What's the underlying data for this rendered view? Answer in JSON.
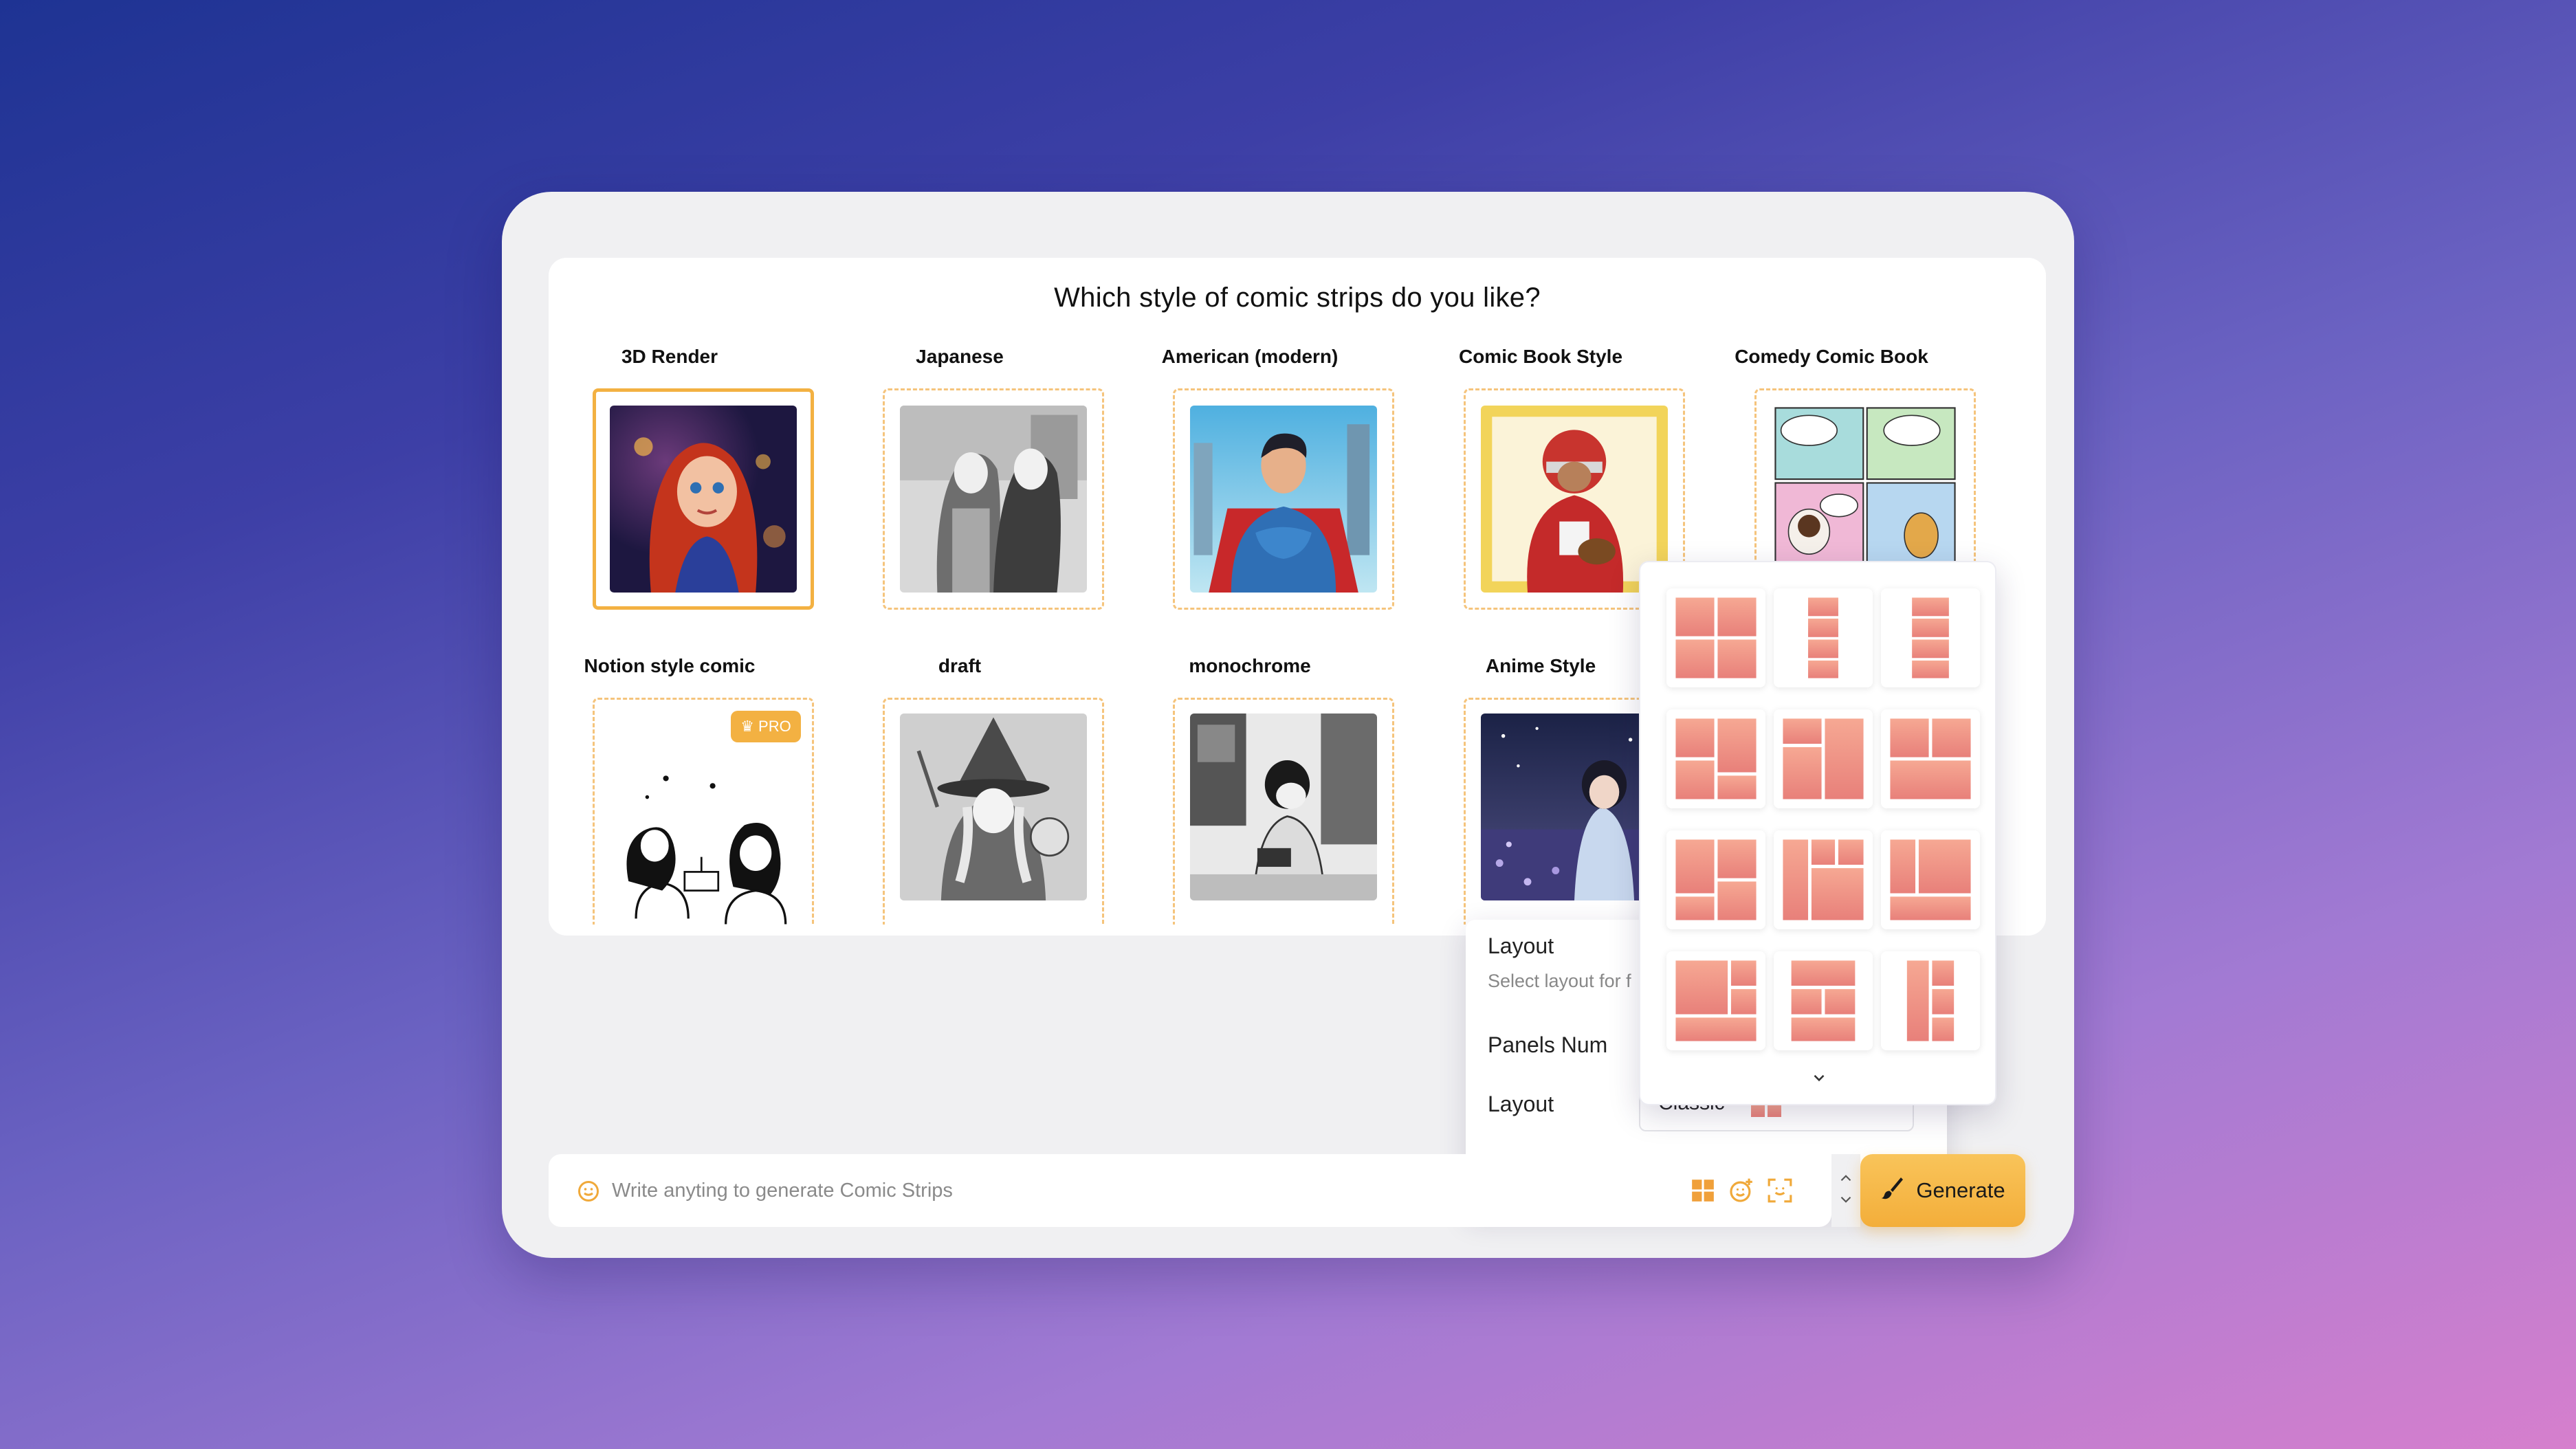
{
  "panel": {
    "title": "Which style of comic strips do you like?"
  },
  "styles": [
    {
      "label": "3D Render",
      "selected": true
    },
    {
      "label": "Japanese"
    },
    {
      "label": "American (modern)"
    },
    {
      "label": "Comic Book Style"
    },
    {
      "label": "Comedy Comic Book"
    },
    {
      "label": "Notion style comic",
      "badge": "PRO"
    },
    {
      "label": "draft"
    },
    {
      "label": "monochrome"
    },
    {
      "label": "Anime Style"
    }
  ],
  "settings": {
    "layout_heading": "Layout",
    "layout_sub": "Select layout for f",
    "panels_num_label": "Panels Num",
    "layout_label": "Layout",
    "layout_value": "Classic"
  },
  "input": {
    "placeholder": "Write anyting to generate Comic Strips"
  },
  "generate_label": "Generate",
  "colors": {
    "accent": "#f3b142",
    "panel_gradient_top": "#f6a893",
    "panel_gradient_bottom": "#e8807a"
  }
}
